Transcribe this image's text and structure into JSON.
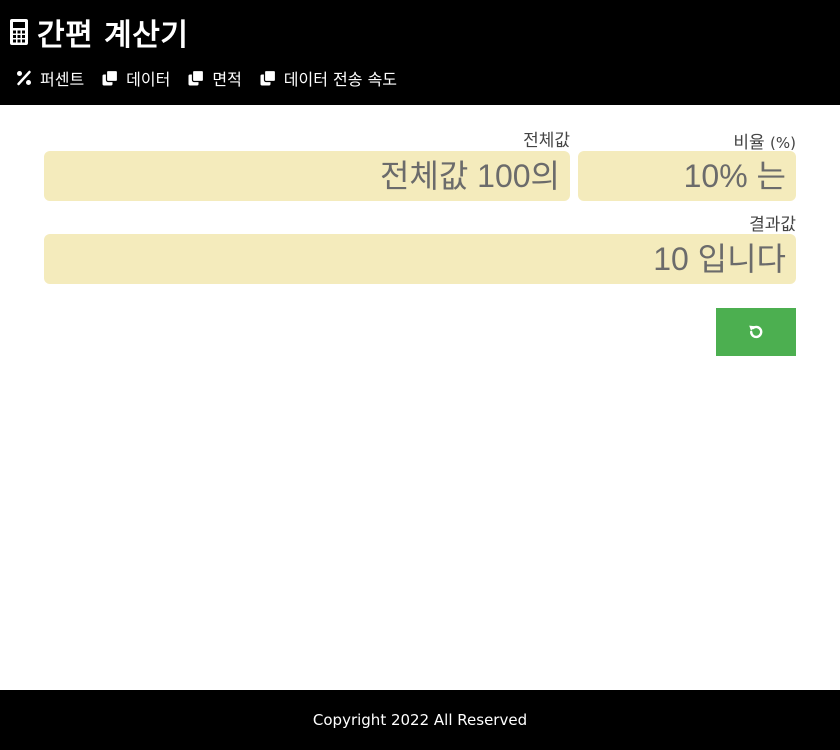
{
  "header": {
    "title": "간편 계산기",
    "icon": "calculator-icon",
    "nav": [
      {
        "label": "퍼센트",
        "icon": "percent-icon"
      },
      {
        "label": "데이터",
        "icon": "copy-icon"
      },
      {
        "label": "면적",
        "icon": "copy-icon"
      },
      {
        "label": "데이터 전송 속도",
        "icon": "copy-icon"
      }
    ]
  },
  "form": {
    "total": {
      "label": "전체값",
      "placeholder": "전체값 100의"
    },
    "ratio": {
      "label": "비율",
      "unit": "(%)",
      "placeholder": "10% 는"
    },
    "result": {
      "label": "결과값",
      "placeholder": "10 입니다"
    },
    "reset_icon": "reset-icon"
  },
  "footer": {
    "copyright": "Copyright 2022 All Reserved"
  },
  "colors": {
    "header_bg": "#000000",
    "field_bg": "#f4ebbc",
    "button_bg": "#4caf50"
  }
}
